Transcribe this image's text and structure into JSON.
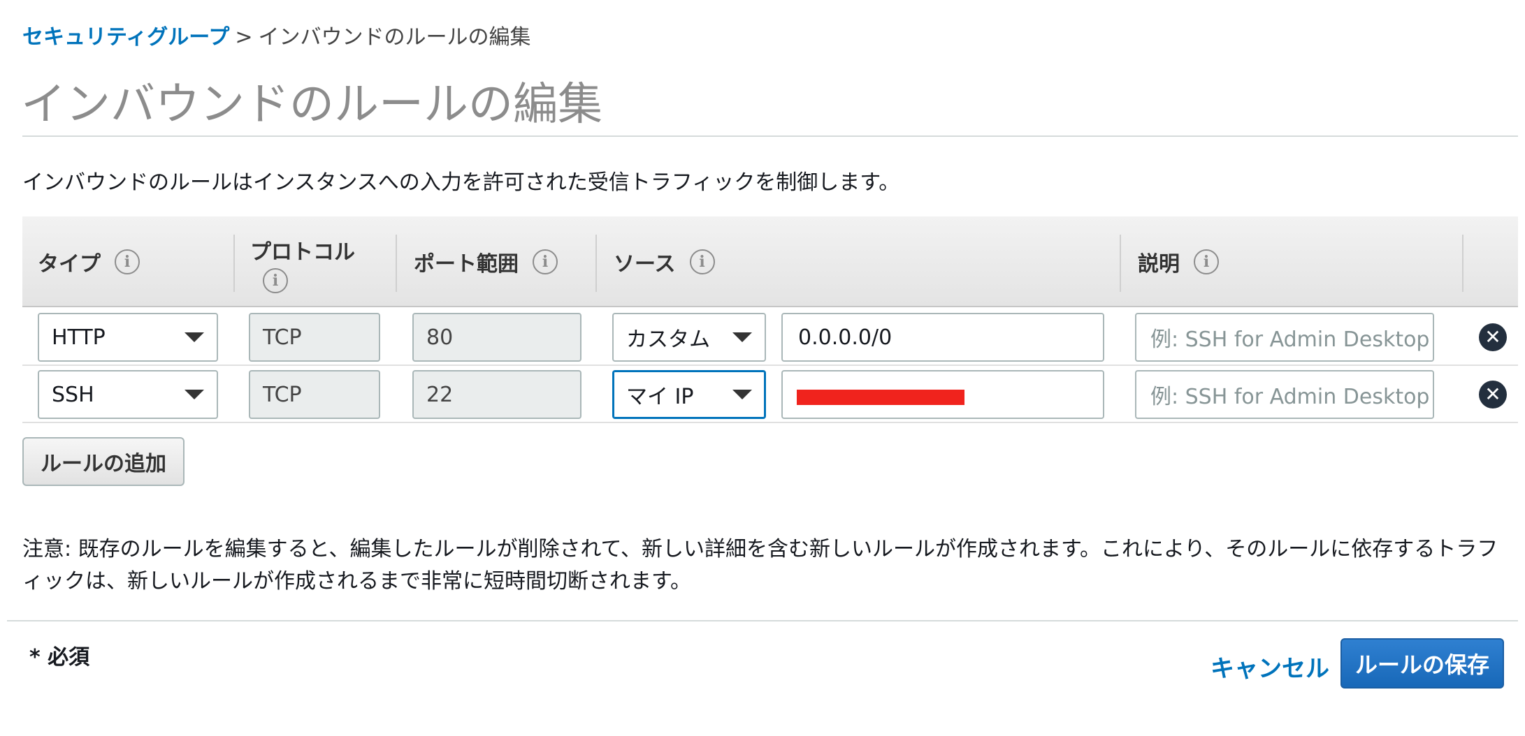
{
  "breadcrumb": {
    "parent": "セキュリティグループ",
    "separator": ">",
    "current": "インバウンドのルールの編集"
  },
  "page_title": "インバウンドのルールの編集",
  "intro": "インバウンドのルールはインスタンスへの入力を許可された受信トラフィックを制御します。",
  "table": {
    "headers": {
      "type": "タイプ",
      "protocol": "プロトコル",
      "port_range": "ポート範囲",
      "source": "ソース",
      "description": "説明"
    },
    "info_glyph": "i",
    "rows": [
      {
        "type": "HTTP",
        "protocol": "TCP",
        "port_range": "80",
        "source_type": "カスタム",
        "source_value": "0.0.0.0/0",
        "description_placeholder": "例: SSH for Admin Desktop"
      },
      {
        "type": "SSH",
        "protocol": "TCP",
        "port_range": "22",
        "source_type": "マイ IP",
        "source_value_redacted": true,
        "description_placeholder": "例: SSH for Admin Desktop"
      }
    ],
    "remove_glyph": "✕"
  },
  "add_rule_label": "ルールの追加",
  "note": "注意: 既存のルールを編集すると、編集したルールが削除されて、新しい詳細を含む新しいルールが作成されます。これにより、そのルールに依存するトラフィックは、新しいルールが作成されるまで非常に短時間切断されます。",
  "footer": {
    "required_label": "* 必須",
    "cancel_label": "キャンセル",
    "save_label": "ルールの保存"
  },
  "colors": {
    "link": "#0073bb",
    "primary_button": "#1868b8",
    "redaction": "#f0231d",
    "title_gray": "#8c8c8c"
  },
  "icons": [
    "info-icon",
    "remove-icon",
    "chevron-down-icon"
  ]
}
